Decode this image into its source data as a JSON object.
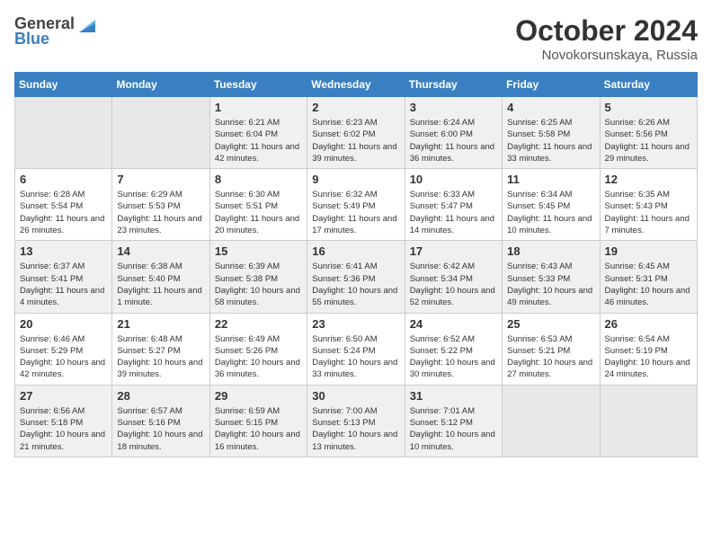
{
  "logo": {
    "general": "General",
    "blue": "Blue"
  },
  "title": "October 2024",
  "location": "Novokorsunskaya, Russia",
  "days_of_week": [
    "Sunday",
    "Monday",
    "Tuesday",
    "Wednesday",
    "Thursday",
    "Friday",
    "Saturday"
  ],
  "weeks": [
    [
      {
        "day": "",
        "empty": true
      },
      {
        "day": "",
        "empty": true
      },
      {
        "day": "1",
        "sunrise": "6:21 AM",
        "sunset": "6:04 PM",
        "daylight": "11 hours and 42 minutes."
      },
      {
        "day": "2",
        "sunrise": "6:23 AM",
        "sunset": "6:02 PM",
        "daylight": "11 hours and 39 minutes."
      },
      {
        "day": "3",
        "sunrise": "6:24 AM",
        "sunset": "6:00 PM",
        "daylight": "11 hours and 36 minutes."
      },
      {
        "day": "4",
        "sunrise": "6:25 AM",
        "sunset": "5:58 PM",
        "daylight": "11 hours and 33 minutes."
      },
      {
        "day": "5",
        "sunrise": "6:26 AM",
        "sunset": "5:56 PM",
        "daylight": "11 hours and 29 minutes."
      }
    ],
    [
      {
        "day": "6",
        "sunrise": "6:28 AM",
        "sunset": "5:54 PM",
        "daylight": "11 hours and 26 minutes."
      },
      {
        "day": "7",
        "sunrise": "6:29 AM",
        "sunset": "5:53 PM",
        "daylight": "11 hours and 23 minutes."
      },
      {
        "day": "8",
        "sunrise": "6:30 AM",
        "sunset": "5:51 PM",
        "daylight": "11 hours and 20 minutes."
      },
      {
        "day": "9",
        "sunrise": "6:32 AM",
        "sunset": "5:49 PM",
        "daylight": "11 hours and 17 minutes."
      },
      {
        "day": "10",
        "sunrise": "6:33 AM",
        "sunset": "5:47 PM",
        "daylight": "11 hours and 14 minutes."
      },
      {
        "day": "11",
        "sunrise": "6:34 AM",
        "sunset": "5:45 PM",
        "daylight": "11 hours and 10 minutes."
      },
      {
        "day": "12",
        "sunrise": "6:35 AM",
        "sunset": "5:43 PM",
        "daylight": "11 hours and 7 minutes."
      }
    ],
    [
      {
        "day": "13",
        "sunrise": "6:37 AM",
        "sunset": "5:41 PM",
        "daylight": "11 hours and 4 minutes."
      },
      {
        "day": "14",
        "sunrise": "6:38 AM",
        "sunset": "5:40 PM",
        "daylight": "11 hours and 1 minute."
      },
      {
        "day": "15",
        "sunrise": "6:39 AM",
        "sunset": "5:38 PM",
        "daylight": "10 hours and 58 minutes."
      },
      {
        "day": "16",
        "sunrise": "6:41 AM",
        "sunset": "5:36 PM",
        "daylight": "10 hours and 55 minutes."
      },
      {
        "day": "17",
        "sunrise": "6:42 AM",
        "sunset": "5:34 PM",
        "daylight": "10 hours and 52 minutes."
      },
      {
        "day": "18",
        "sunrise": "6:43 AM",
        "sunset": "5:33 PM",
        "daylight": "10 hours and 49 minutes."
      },
      {
        "day": "19",
        "sunrise": "6:45 AM",
        "sunset": "5:31 PM",
        "daylight": "10 hours and 46 minutes."
      }
    ],
    [
      {
        "day": "20",
        "sunrise": "6:46 AM",
        "sunset": "5:29 PM",
        "daylight": "10 hours and 42 minutes."
      },
      {
        "day": "21",
        "sunrise": "6:48 AM",
        "sunset": "5:27 PM",
        "daylight": "10 hours and 39 minutes."
      },
      {
        "day": "22",
        "sunrise": "6:49 AM",
        "sunset": "5:26 PM",
        "daylight": "10 hours and 36 minutes."
      },
      {
        "day": "23",
        "sunrise": "6:50 AM",
        "sunset": "5:24 PM",
        "daylight": "10 hours and 33 minutes."
      },
      {
        "day": "24",
        "sunrise": "6:52 AM",
        "sunset": "5:22 PM",
        "daylight": "10 hours and 30 minutes."
      },
      {
        "day": "25",
        "sunrise": "6:53 AM",
        "sunset": "5:21 PM",
        "daylight": "10 hours and 27 minutes."
      },
      {
        "day": "26",
        "sunrise": "6:54 AM",
        "sunset": "5:19 PM",
        "daylight": "10 hours and 24 minutes."
      }
    ],
    [
      {
        "day": "27",
        "sunrise": "6:56 AM",
        "sunset": "5:18 PM",
        "daylight": "10 hours and 21 minutes."
      },
      {
        "day": "28",
        "sunrise": "6:57 AM",
        "sunset": "5:16 PM",
        "daylight": "10 hours and 18 minutes."
      },
      {
        "day": "29",
        "sunrise": "6:59 AM",
        "sunset": "5:15 PM",
        "daylight": "10 hours and 16 minutes."
      },
      {
        "day": "30",
        "sunrise": "7:00 AM",
        "sunset": "5:13 PM",
        "daylight": "10 hours and 13 minutes."
      },
      {
        "day": "31",
        "sunrise": "7:01 AM",
        "sunset": "5:12 PM",
        "daylight": "10 hours and 10 minutes."
      },
      {
        "day": "",
        "empty": true
      },
      {
        "day": "",
        "empty": true
      }
    ]
  ],
  "labels": {
    "sunrise": "Sunrise:",
    "sunset": "Sunset:",
    "daylight": "Daylight:"
  }
}
